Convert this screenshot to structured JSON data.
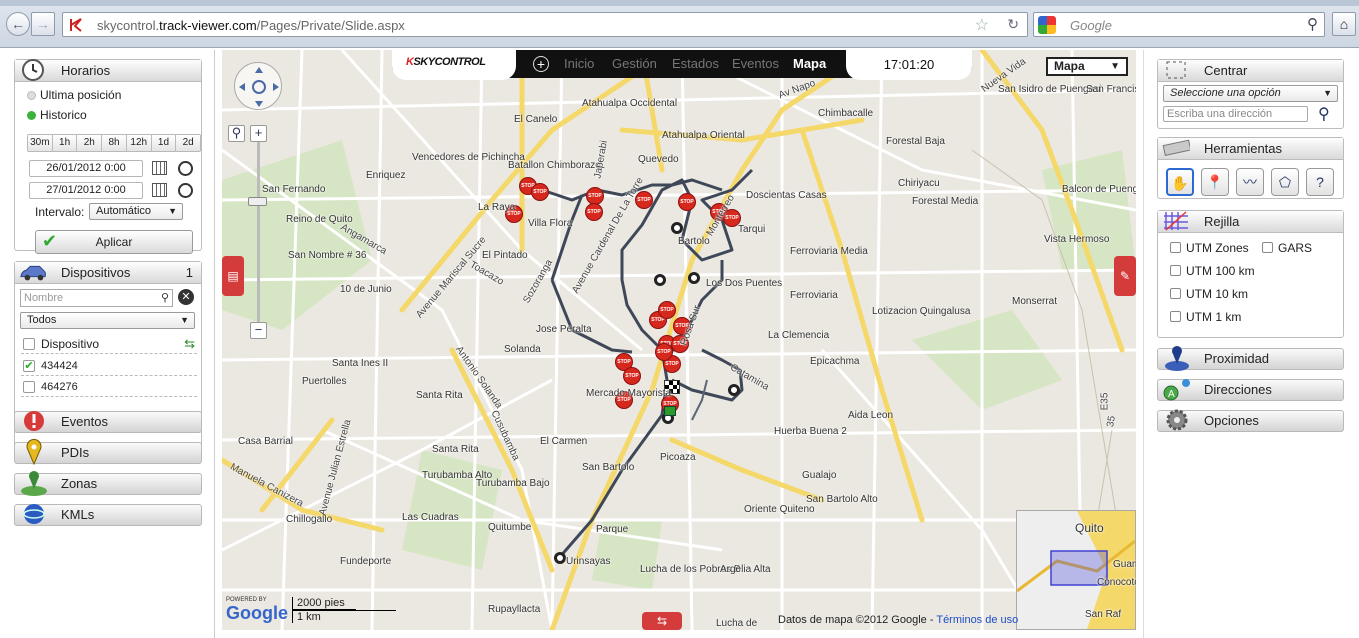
{
  "browser": {
    "url_prefix": "skycontrol.",
    "url_domain": "track-viewer.com",
    "url_path": "/Pages/Private/Slide.aspx",
    "search_placeholder": "Google"
  },
  "left": {
    "horarios": {
      "title": "Horarios",
      "ultima": "Ultima posición",
      "historico": "Historico",
      "intervals": [
        "30m",
        "1h",
        "2h",
        "8h",
        "12h",
        "1d",
        "2d"
      ],
      "date_from": "26/01/2012 0:00",
      "date_to": "27/01/2012 0:00",
      "intervalo_label": "Intervalo:",
      "intervalo_value": "Automático",
      "apply": "Aplicar"
    },
    "dispositivos": {
      "title": "Dispositivos",
      "count": "1",
      "search_placeholder": "Nombre",
      "filter": "Todos",
      "header": "Dispositivo",
      "items": [
        {
          "name": "434424",
          "checked": true
        },
        {
          "name": "464276",
          "checked": false
        }
      ]
    },
    "sections": [
      "Eventos",
      "PDIs",
      "Zonas",
      "KMLs"
    ]
  },
  "map": {
    "nav": [
      "Inicio",
      "Gestión",
      "Estados",
      "Eventos",
      "Mapa"
    ],
    "active_nav": "Mapa",
    "clock": "17:01:20",
    "map_type": "Mapa",
    "logo": "SKYCONTROL",
    "scale_feet": "2000 pies",
    "scale_km": "1 km",
    "powered_by": "POWERED BY",
    "google": "Google",
    "copyright": "Datos de mapa ©2012 Google -",
    "terms": "Términos de uso",
    "labels": [
      "Atahualpa Occidental",
      "Atahualpa Oriental",
      "Chimbacalle",
      "Forestal Baja",
      "San Isidro de Puengasi",
      "San Francisco",
      "Vencedores de Pichincha",
      "Batallon Chimborazo",
      "El Canelo",
      "Quevedo",
      "Doscientas Casas",
      "Chiriyacu",
      "Forestal Media",
      "Balcon de Puengasi",
      "San Fernando",
      "Enriquez",
      "La Raya",
      "Villa Flora",
      "Reino de Quito",
      "El Pintado",
      "Bartolo",
      "Ferroviaria Media",
      "Vista Hermoso",
      "Tarqui",
      "Jose Peralta",
      "San Nombre # 36",
      "10 de Junio",
      "Los Dos Puentes",
      "Ferroviaria",
      "Lotizacion Quingalusa",
      "Monserrat",
      "Santa Ines II",
      "Puertolles",
      "La Clemencia",
      "Epicachma",
      "Solanda",
      "Mercado Mayorista",
      "Santa Rita",
      "El Carmen",
      "Aida Leon",
      "Huerba Buena 2",
      "Casa Barrial",
      "Santa Rita",
      "Turubamba Alto",
      "Turubamba Bajo",
      "San Bartolo",
      "Picoaza",
      "Gualajo",
      "San Bartolo Alto",
      "Oriente Quiteno",
      "Chillogallo",
      "Las Cuadras",
      "Quitumbe",
      "Parque",
      "Fundeporte",
      "Urinsayas",
      "Lucha de los Pobres B",
      "Argelia Alta",
      "Rupayllacta",
      "Lucha de",
      "Quito",
      "Guam",
      "Conocoto",
      "San Raf"
    ],
    "roads": [
      "Avenue Mariscal Sucre",
      "Toacazo",
      "Sozoranga",
      "Avenue Cardenal De La Torre",
      "Japerabi",
      "Cusubamba",
      "Antonio Solanda",
      "Avenue Julian Estrella",
      "Manuela Canizera",
      "Catamina",
      "Angamarca",
      "Napo",
      "Av Napo",
      "Monterreo",
      "Nueva Vida",
      "Rosa Sur",
      "E35",
      "35"
    ]
  },
  "right": {
    "centrar": {
      "title": "Centrar",
      "select": "Seleccione una opción",
      "address_placeholder": "Escriba una dirección"
    },
    "herramientas": {
      "title": "Herramientas",
      "tools": [
        "hand",
        "pin",
        "line",
        "polygon",
        "?"
      ]
    },
    "rejilla": {
      "title": "Rejilla",
      "options": [
        "UTM Zones",
        "GARS",
        "UTM 100 km",
        "UTM 10 km",
        "UTM 1 km"
      ]
    },
    "sections": [
      "Proximidad",
      "Direcciones",
      "Opciones"
    ]
  },
  "colors": {
    "accent": "#d43c3c",
    "route": "#404a5a",
    "road_yellow": "#f5d86a"
  }
}
